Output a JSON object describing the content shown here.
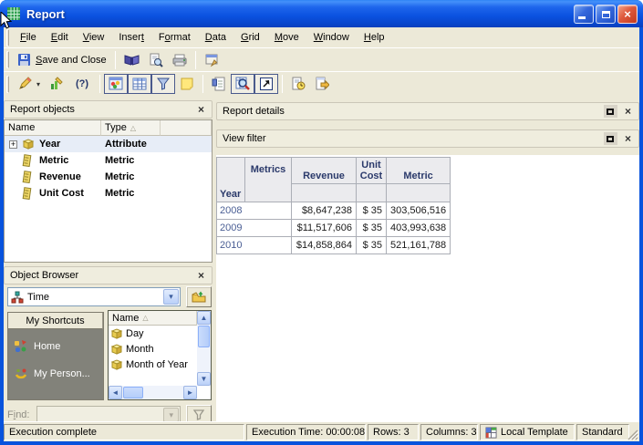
{
  "colors": {
    "titlebar_blue": "#0853DD",
    "client_beige": "#ECE9D8",
    "close_button_red": "#D8492B",
    "grid_header_bg": "#EBEBEE",
    "grid_header_text": "#2B3A6B",
    "grid_year_text": "#4A5E94",
    "tree_selection_bg": "#E7EDF7",
    "shortcuts_bg": "#82827A"
  },
  "titlebar": {
    "title": "Report"
  },
  "menu": {
    "items": [
      {
        "pre": "",
        "key": "F",
        "post": "ile"
      },
      {
        "pre": "",
        "key": "E",
        "post": "dit"
      },
      {
        "pre": "",
        "key": "V",
        "post": "iew"
      },
      {
        "pre": "Inser",
        "key": "t",
        "post": ""
      },
      {
        "pre": "F",
        "key": "o",
        "post": "rmat"
      },
      {
        "pre": "",
        "key": "D",
        "post": "ata"
      },
      {
        "pre": "",
        "key": "G",
        "post": "rid"
      },
      {
        "pre": "",
        "key": "M",
        "post": "ove"
      },
      {
        "pre": "",
        "key": "W",
        "post": "indow"
      },
      {
        "pre": "",
        "key": "H",
        "post": "elp"
      }
    ]
  },
  "toolbars": {
    "save_and_close": {
      "pre": "",
      "key": "S",
      "post": "ave and Close"
    },
    "help_label": "(?)"
  },
  "icons": {
    "close_glyph": "×",
    "expand_plus": "+",
    "sort_asc": "△",
    "combo_arrow": "▾",
    "caret_down": "▾",
    "scroll_up": "▲",
    "scroll_down": "▼",
    "scroll_left": "◄",
    "scroll_right": "►"
  },
  "report_objects": {
    "title": "Report objects",
    "name_col": "Name",
    "type_col": "Type",
    "rows": [
      {
        "name": "Year",
        "type": "Attribute"
      },
      {
        "name": "Metric",
        "type": "Metric"
      },
      {
        "name": "Revenue",
        "type": "Metric"
      },
      {
        "name": "Unit Cost",
        "type": "Metric"
      }
    ]
  },
  "object_browser": {
    "title": "Object Browser",
    "selected": "Time",
    "shortcuts_title": "My Shortcuts",
    "shortcuts": [
      {
        "label": "Home"
      },
      {
        "label": "My Person..."
      }
    ],
    "list_header": "Name",
    "list_items": [
      {
        "label": "Day"
      },
      {
        "label": "Month"
      },
      {
        "label": "Month of Year"
      }
    ],
    "find_pre": "F",
    "find_key": "i",
    "find_post": "nd:"
  },
  "panels": {
    "report_details_title": "Report details",
    "view_filter_title": "View filter"
  },
  "grid": {
    "row_axis": "Year",
    "col_axis": "Metrics",
    "columns": [
      "Revenue",
      "Unit Cost",
      "Metric"
    ],
    "rows": [
      {
        "year": "2008",
        "values": [
          "$8,647,238",
          "$ 35",
          "303,506,516"
        ]
      },
      {
        "year": "2009",
        "values": [
          "$11,517,606",
          "$ 35",
          "403,993,638"
        ]
      },
      {
        "year": "2010",
        "values": [
          "$14,858,864",
          "$ 35",
          "521,161,788"
        ]
      }
    ]
  },
  "status_bar": {
    "message": "Execution complete",
    "execution_time": "Execution Time: 00:00:08",
    "rows": "Rows: 3",
    "columns": "Columns: 3",
    "template": "Local Template",
    "mode": "Standard"
  }
}
